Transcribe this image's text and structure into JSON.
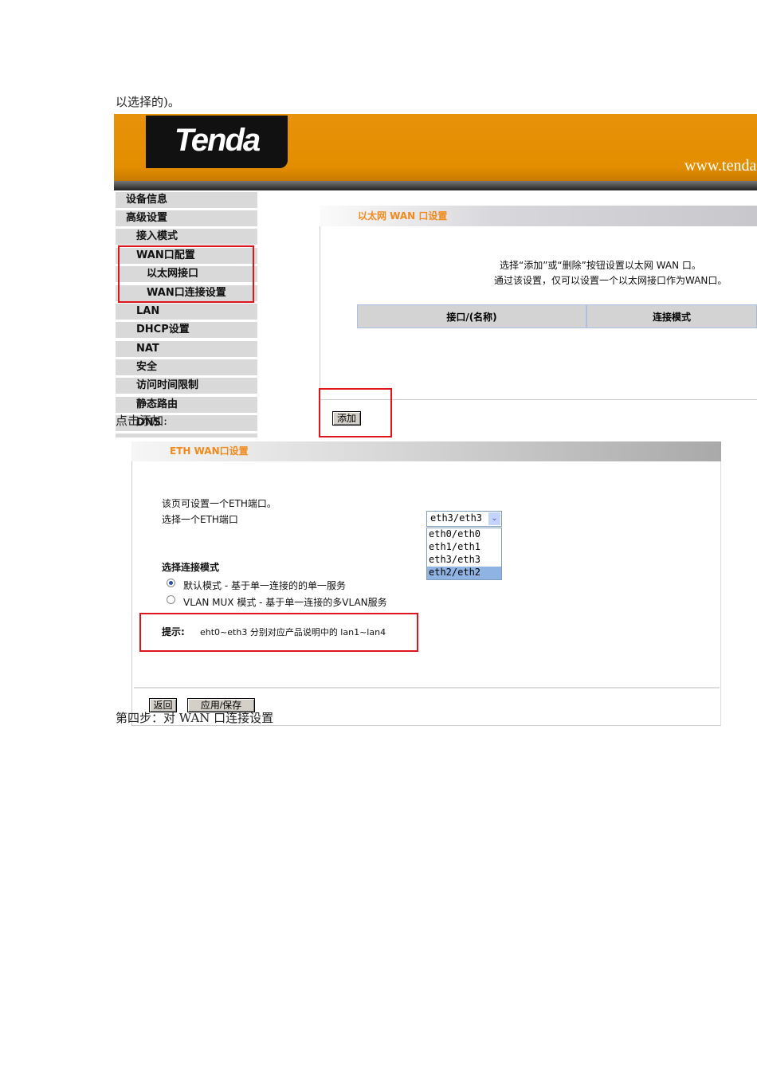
{
  "doc": {
    "line1": "以选择的)。",
    "line2": "点击添加:",
    "line3": "第四步：对 WAN 口连接设置"
  },
  "shot1": {
    "logo": "Tenda",
    "url": "www.tenda",
    "sidebar": [
      "设备信息",
      "高级设置",
      "接入模式",
      "WAN口配置",
      "以太网接口",
      "WAN口连接设置",
      "LAN",
      "DHCP设置",
      "NAT",
      "安全",
      "访问时间限制",
      "静态路由",
      "DNS"
    ],
    "panel_title": "以太网 WAN 口设置",
    "intro1": "选择“添加”或“删除”按钮设置以太网 WAN 口。",
    "intro2": "通过该设置，仅可以设置一个以太网接口作为WAN口。",
    "columns": [
      "接口/(名称)",
      "连接模式"
    ],
    "add_button": "添加"
  },
  "shot2": {
    "panel_title": "ETH WAN口设置",
    "desc": "该页可设置一个ETH端口。",
    "select_label": "选择一个ETH端口",
    "selected": "eth3/eth3",
    "options": [
      "eth0/eth0",
      "eth1/eth1",
      "eth3/eth3",
      "eth2/eth2"
    ],
    "mode_label": "选择连接模式",
    "modes": [
      "默认模式 - 基于单一连接的的单一服务",
      "VLAN MUX 模式 - 基于单一连接的多VLAN服务"
    ],
    "hint_label": "提示:",
    "hint": "eht0~eth3 分别对应产品说明中的 lan1~lan4",
    "back_button": "返回",
    "apply_button": "应用/保存"
  }
}
